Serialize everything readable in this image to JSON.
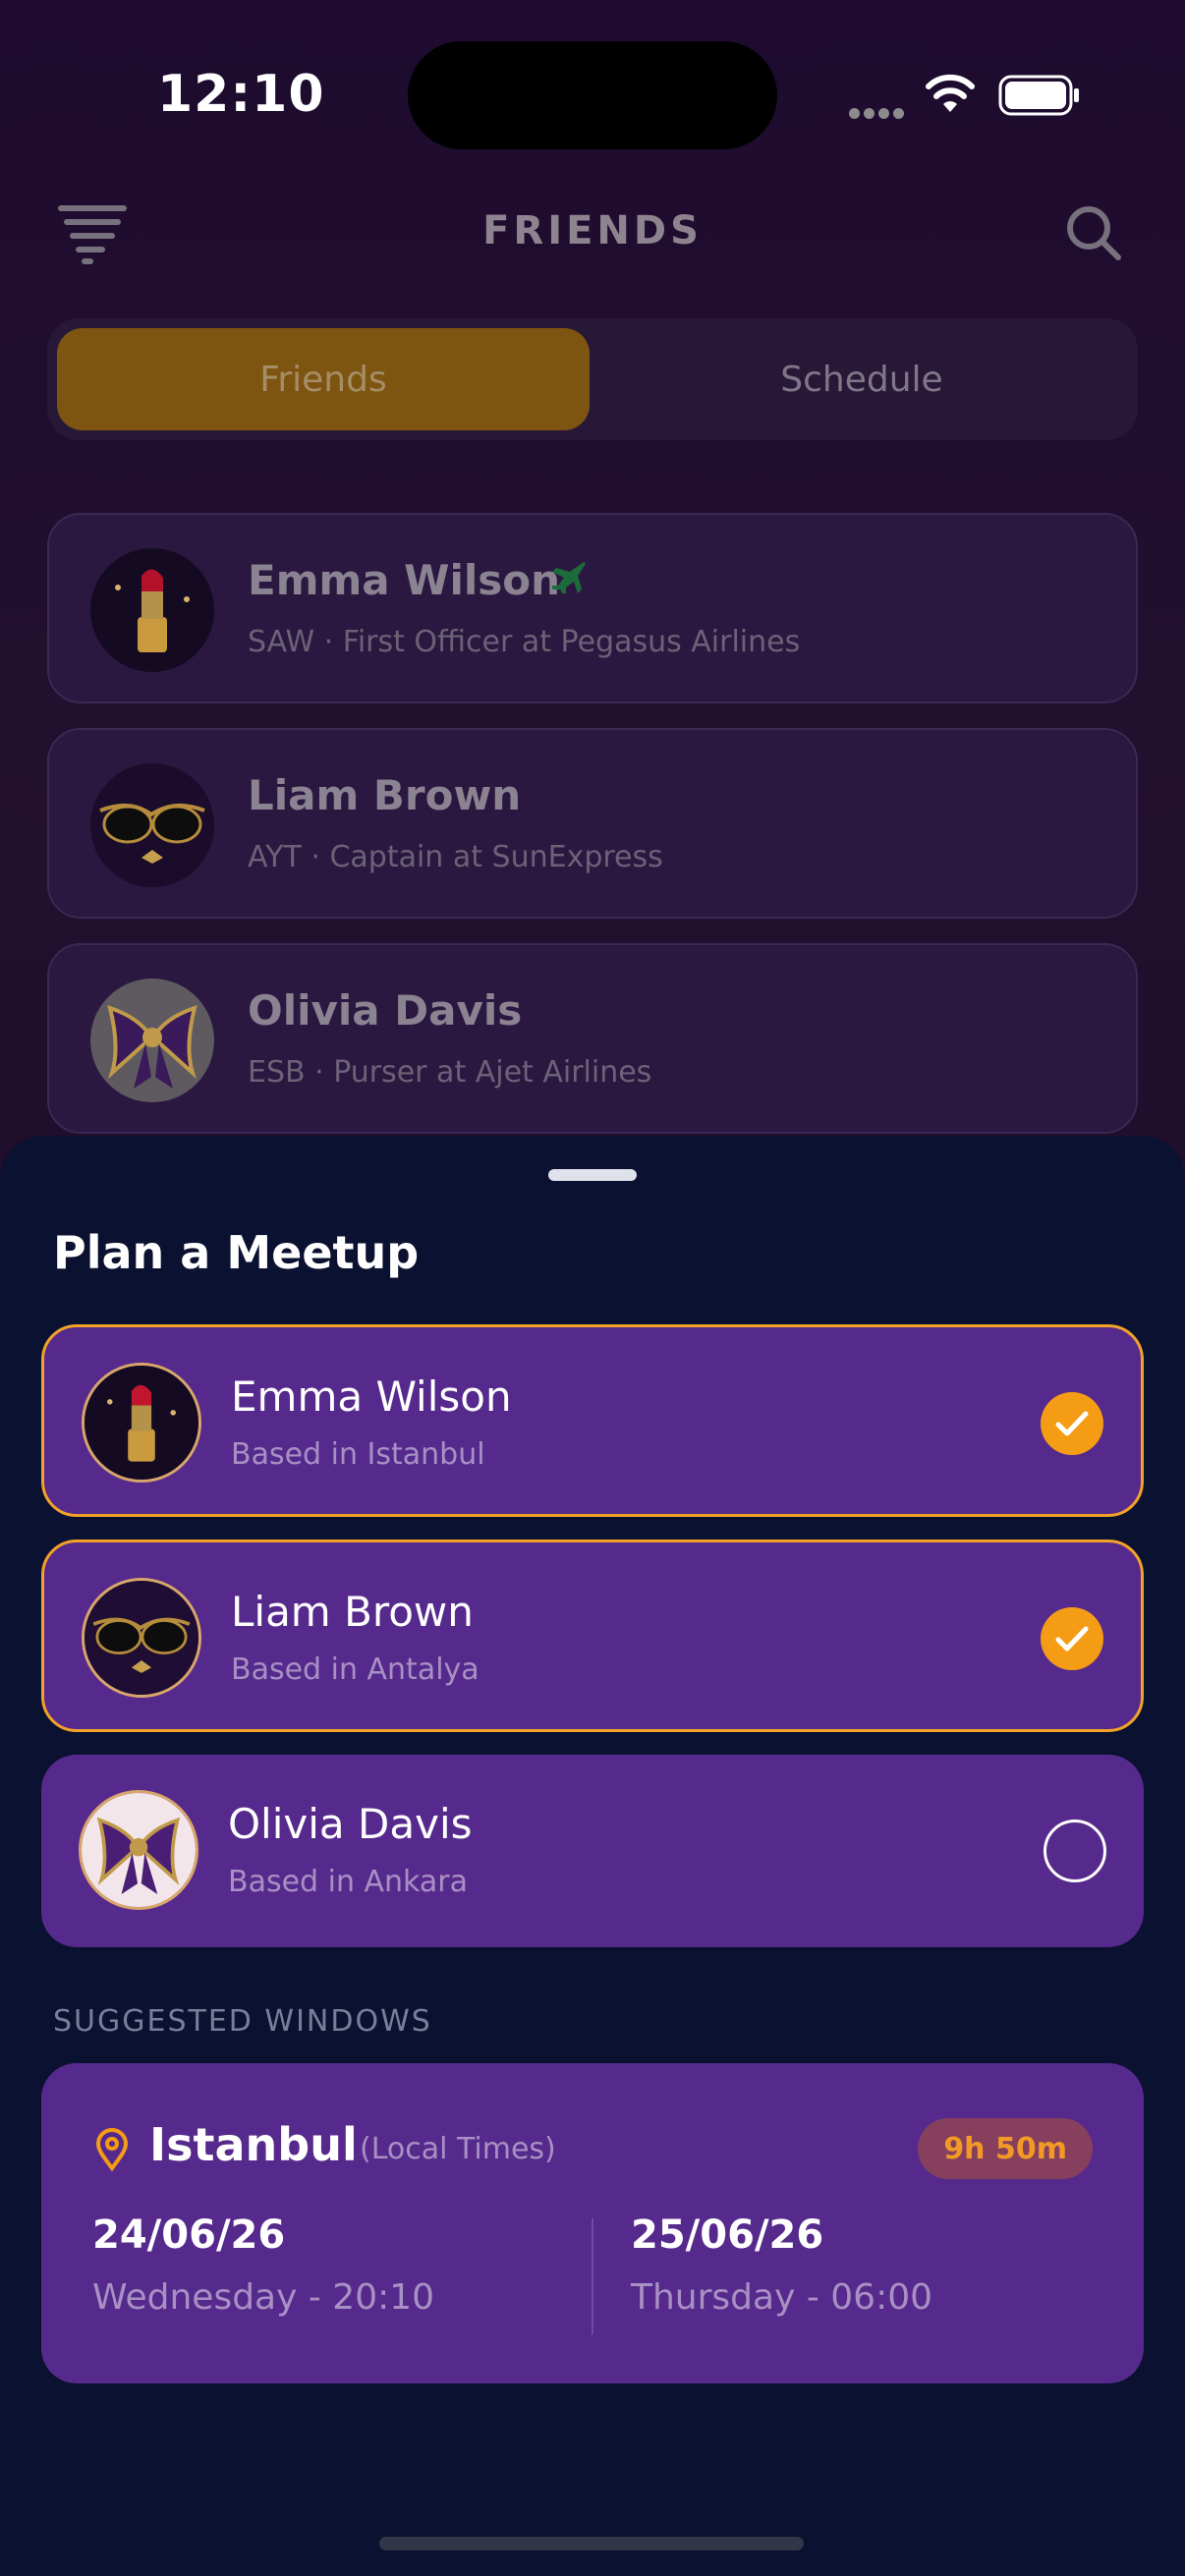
{
  "status": {
    "time": "12:10"
  },
  "header": {
    "title": "FRIENDS"
  },
  "tabs": [
    {
      "label": "Friends",
      "active": true
    },
    {
      "label": "Schedule",
      "active": false
    }
  ],
  "friends": [
    {
      "name": "Emma Wilson",
      "subtitle": "SAW · First Officer at Pegasus Airlines",
      "avatar": "lipstick-avatar",
      "badge": "plane-icon"
    },
    {
      "name": "Liam Brown",
      "subtitle": "AYT · Captain at SunExpress",
      "avatar": "sunglasses-avatar"
    },
    {
      "name": "Olivia Davis",
      "subtitle": "ESB · Purser at Ajet Airlines",
      "avatar": "scarf-avatar"
    }
  ],
  "sheet": {
    "title": "Plan a Meetup",
    "people": [
      {
        "name": "Emma Wilson",
        "subtitle": "Based in Istanbul",
        "selected": true
      },
      {
        "name": "Liam Brown",
        "subtitle": "Based in Antalya",
        "selected": true
      },
      {
        "name": "Olivia Davis",
        "subtitle": "Based in Ankara",
        "selected": false
      }
    ],
    "section_label": "SUGGESTED WINDOWS",
    "window": {
      "city": "Istanbul",
      "local_label": "(Local Times)",
      "duration": "9h 50m",
      "start_date": "24/06/26",
      "start_time": "Wednesday - 20:10",
      "end_date": "25/06/26",
      "end_time": "Thursday - 06:00"
    }
  },
  "colors": {
    "accent": "#f49d14",
    "card": "#562a8c",
    "sheet": "#0b1130"
  }
}
